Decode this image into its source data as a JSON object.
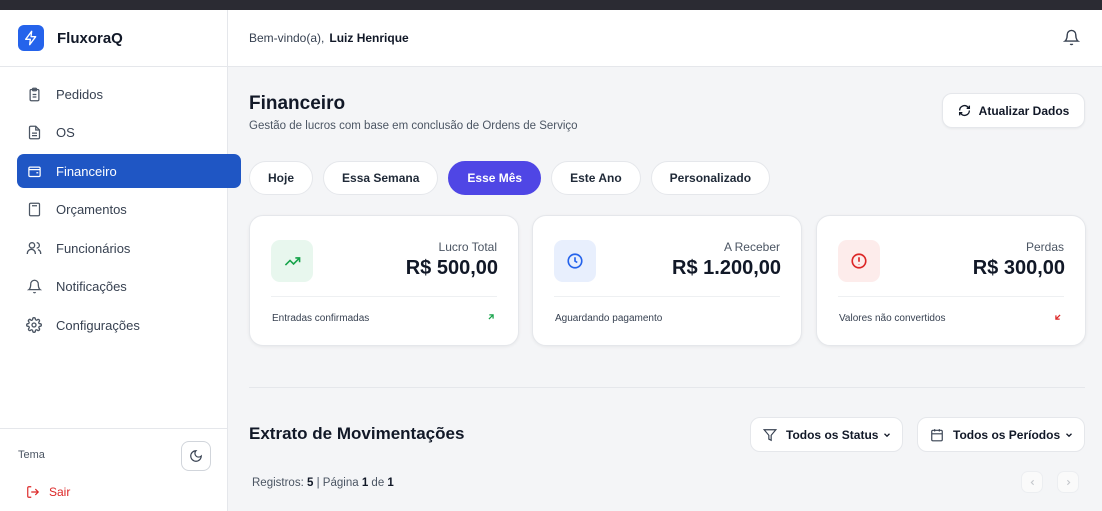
{
  "brand": {
    "name": "FluxoraQ",
    "logo_icon": "lightning-icon",
    "accent": "#2563eb"
  },
  "sidebar": {
    "items": [
      {
        "label": "Pedidos",
        "icon": "clipboard-icon",
        "active": false
      },
      {
        "label": "OS",
        "icon": "file-text-icon",
        "active": false
      },
      {
        "label": "Financeiro",
        "icon": "wallet-icon",
        "active": true
      },
      {
        "label": "Orçamentos",
        "icon": "calculator-icon",
        "active": false
      },
      {
        "label": "Funcionários",
        "icon": "users-icon",
        "active": false
      },
      {
        "label": "Notificações",
        "icon": "bell-icon",
        "active": false
      },
      {
        "label": "Configurações",
        "icon": "gear-icon",
        "active": false
      }
    ],
    "active_color": "#1f56c4",
    "theme_label": "Tema",
    "logout_label": "Sair"
  },
  "header": {
    "greeting": "Bem-vindo(a),",
    "user_name": "Luiz Henrique"
  },
  "page": {
    "title": "Financeiro",
    "subtitle": "Gestão de lucros com base em conclusão de Ordens de Serviço",
    "refresh_label": "Atualizar Dados"
  },
  "period_tabs": [
    {
      "label": "Hoje",
      "active": false
    },
    {
      "label": "Essa Semana",
      "active": false
    },
    {
      "label": "Esse Mês",
      "active": true
    },
    {
      "label": "Este Ano",
      "active": false
    },
    {
      "label": "Personalizado",
      "active": false
    }
  ],
  "cards": [
    {
      "label": "Lucro Total",
      "value": "R$ 500,00",
      "footer": "Entradas confirmadas",
      "icon": "trending-up-icon",
      "color": "#16a34a"
    },
    {
      "label": "A Receber",
      "value": "R$ 1.200,00",
      "footer": "Aguardando pagamento",
      "icon": "clock-icon",
      "color": "#2563eb"
    },
    {
      "label": "Perdas",
      "value": "R$ 300,00",
      "footer": "Valores não convertidos",
      "icon": "alert-circle-icon",
      "color": "#dc2626"
    }
  ],
  "statement": {
    "title": "Extrato de Movimentações",
    "status_filter": "Todos os Status",
    "period_filter": "Todos os Períodos",
    "records_label": "Registros:",
    "records_count": "5",
    "page_label": "Página",
    "page_current": "1",
    "page_of": "de",
    "page_total": "1"
  }
}
